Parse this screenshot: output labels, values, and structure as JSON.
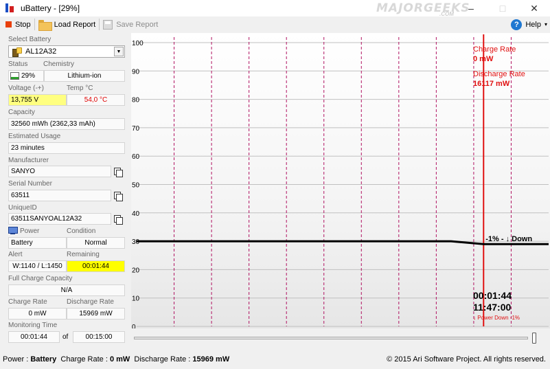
{
  "window": {
    "title": "uBattery - [29%]",
    "watermark": "MAJORGEEKS",
    "watermark_sub": ".COM"
  },
  "toolbar": {
    "stop_label": "Stop",
    "load_label": "Load Report",
    "save_label": "Save Report",
    "help_label": "Help"
  },
  "panel": {
    "select_battery_label": "Select Battery",
    "selected_battery": "AL12A32",
    "status_label": "Status",
    "chemistry_label": "Chemistry",
    "status_value": "29%",
    "status_level": 0.29,
    "chemistry_value": "Lithium-ion",
    "voltage_label": "Voltage (-+)",
    "temp_label": "Temp °C",
    "voltage_value": "13,755 V",
    "temp_value": "54,0 °C",
    "capacity_label": "Capacity",
    "capacity_value": "32560 mWh (2362,33 mAh)",
    "usage_label": "Estimated Usage",
    "usage_value": "23 minutes",
    "manufacturer_label": "Manufacturer",
    "manufacturer_value": "SANYO",
    "serial_label": "Serial Number",
    "serial_value": "63511",
    "uniqueid_label": "UniqueID",
    "uniqueid_value": "63511SANYOAL12A32",
    "power_label": "Power",
    "condition_label": "Condition",
    "power_value": "Battery",
    "condition_value": "Normal",
    "alert_label": "Alert",
    "remaining_label": "Remaining",
    "alert_value": "W:1140 / L:1450",
    "remaining_value": "00:01:44",
    "full_charge_label": "Full Charge Capacity",
    "full_charge_value": "N/A",
    "charge_rate_label": "Charge Rate",
    "discharge_rate_label": "Discharge Rate",
    "charge_rate_value": "0 mW",
    "discharge_rate_value": "15969 mW",
    "monitoring_label": "Monitoring Time",
    "monitoring_value": "00:01:44",
    "monitoring_of": "of",
    "monitoring_total": "00:15:00"
  },
  "chart": {
    "charge_rate_label": "Charge Rate",
    "charge_rate_value": "0 mW",
    "discharge_rate_label": "Discharge Rate",
    "discharge_rate_value": "16117 mW",
    "annotation": "-1% - ↓ Down",
    "elapsed": "00:01:44",
    "clock": "11:47:00",
    "event_text": "↓ Power Down -1%",
    "colors": {
      "accent": "#e01010",
      "grid": "#c0c0c0",
      "vline": "#b01060",
      "line": "#000000"
    }
  },
  "statusbar": {
    "power_label": "Power :",
    "power_value": "Battery",
    "charge_label": "Charge Rate :",
    "charge_value": "0 mW",
    "discharge_label": "Discharge Rate :",
    "discharge_value": "15969 mW",
    "copyright": "© 2015 Ari Software Project. All rights reserved."
  },
  "chart_data": {
    "type": "line",
    "title": "",
    "xlabel": "",
    "ylabel": "",
    "ylim": [
      0,
      100
    ],
    "y_ticks": [
      "0",
      "10",
      "20",
      "30",
      "40",
      "50",
      "60",
      "70",
      "80",
      "90",
      "100"
    ],
    "series": [
      {
        "x": [
          0,
          29,
          32,
          38
        ],
        "values": [
          30,
          30,
          29,
          29
        ]
      }
    ],
    "x_range": [
      0,
      38
    ],
    "event_x": 32,
    "grid": true
  }
}
